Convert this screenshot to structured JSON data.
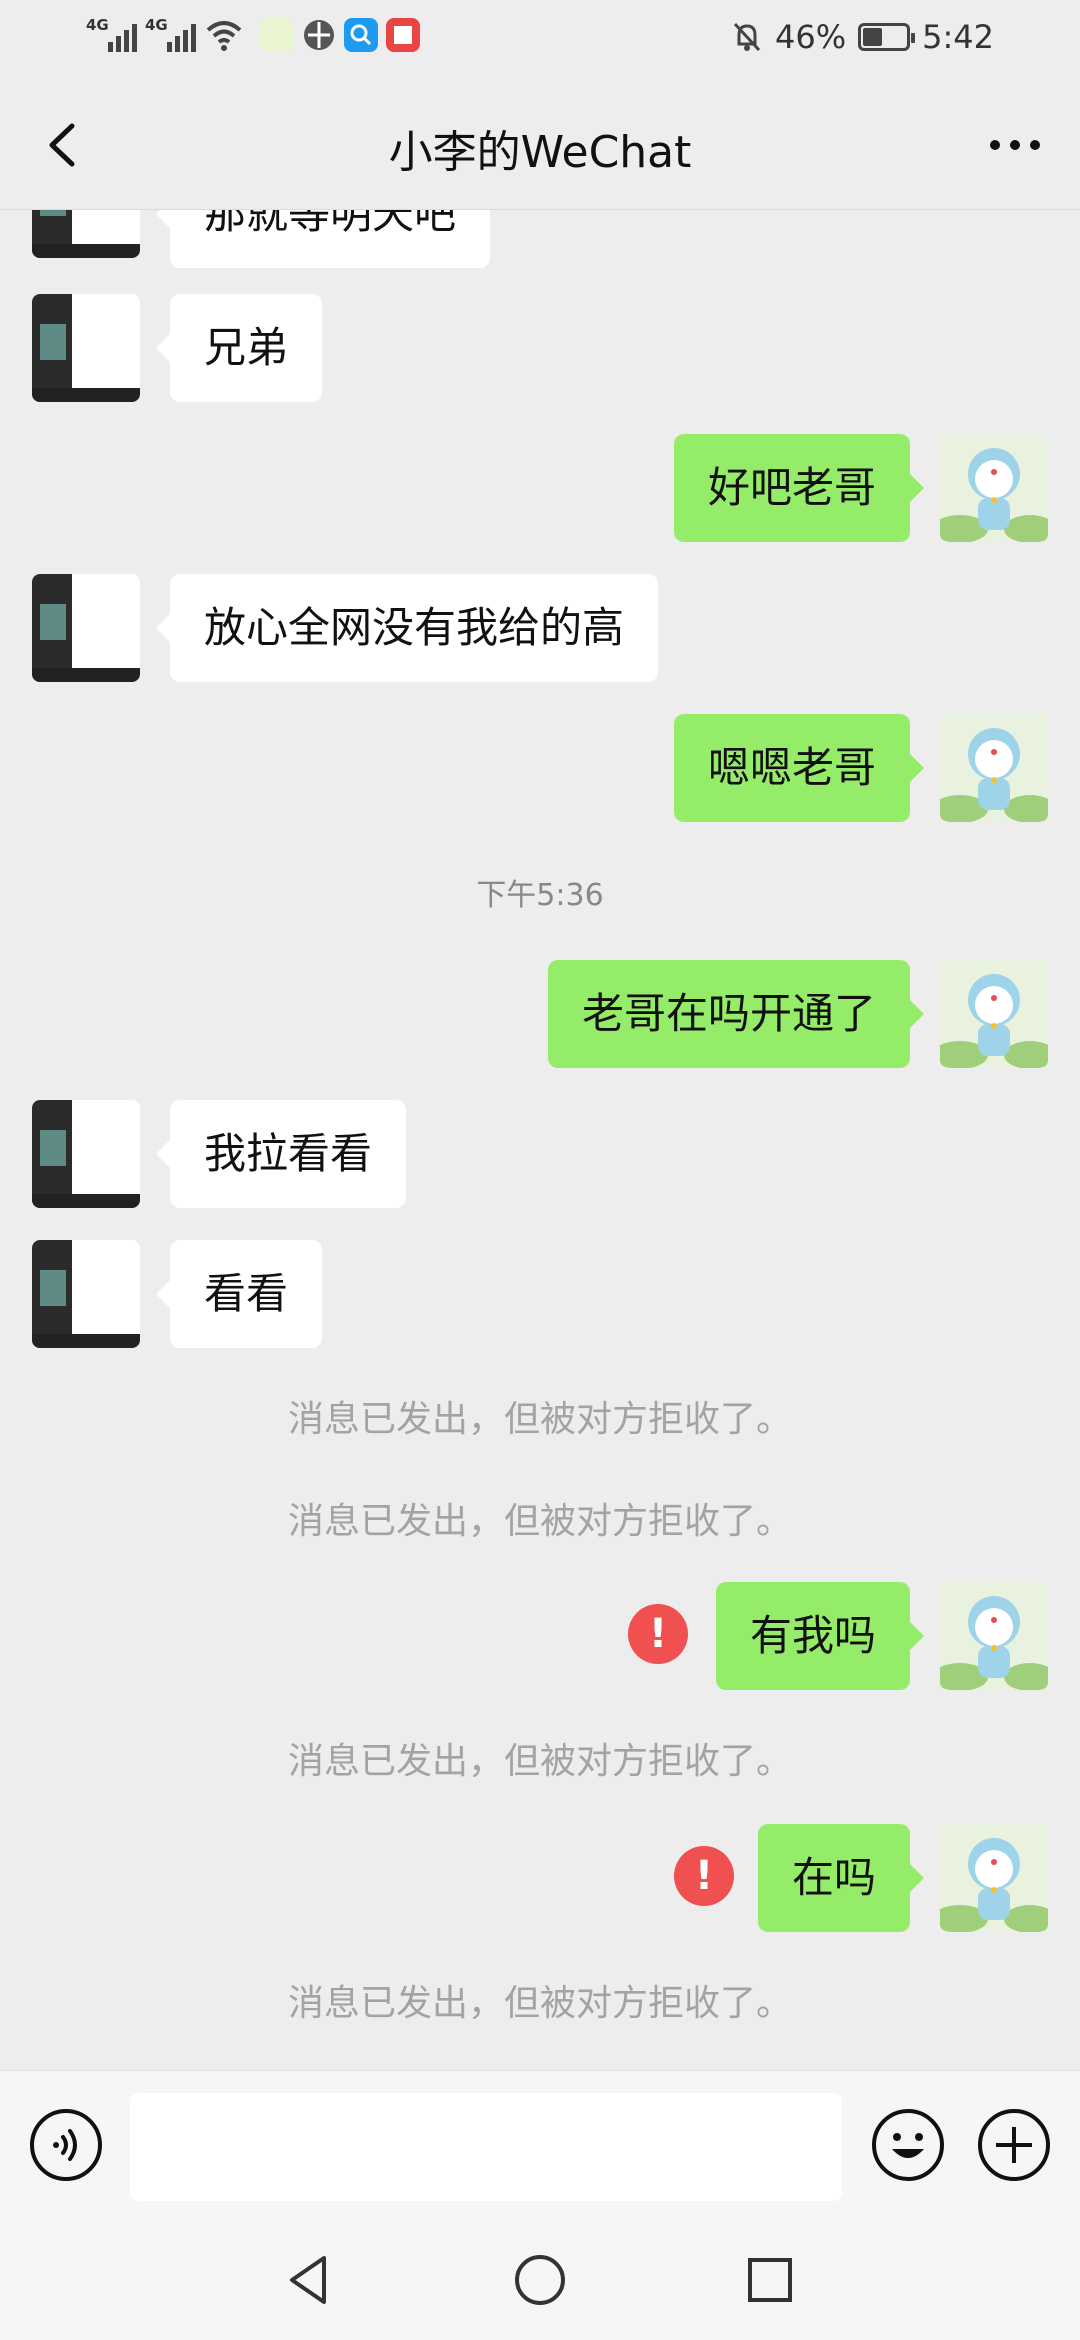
{
  "status_bar": {
    "network_1": "4G",
    "network_2": "4G",
    "battery_percent": "46%",
    "battery_level": 0.46,
    "time": "5:42"
  },
  "header": {
    "title": "小李的WeChat",
    "back_icon": "chevron-left-icon",
    "more_icon": "more-horizontal-icon"
  },
  "messages": [
    {
      "type": "in",
      "text": "那就等明天吧"
    },
    {
      "type": "in",
      "text": "兄弟"
    },
    {
      "type": "out",
      "text": "好吧老哥"
    },
    {
      "type": "in",
      "text": "放心全网没有我给的高"
    },
    {
      "type": "out",
      "text": "嗯嗯老哥"
    },
    {
      "type": "time",
      "text": "下午5:36"
    },
    {
      "type": "out",
      "text": "老哥在吗开通了"
    },
    {
      "type": "in",
      "text": "我拉看看"
    },
    {
      "type": "in",
      "text": "看看"
    },
    {
      "type": "system",
      "text": "消息已发出，但被对方拒收了。"
    },
    {
      "type": "system",
      "text": "消息已发出，但被对方拒收了。"
    },
    {
      "type": "out",
      "text": "有我吗",
      "failed": true
    },
    {
      "type": "system",
      "text": "消息已发出，但被对方拒收了。"
    },
    {
      "type": "out",
      "text": "在吗",
      "failed": true
    },
    {
      "type": "system",
      "text": "消息已发出，但被对方拒收了。"
    }
  ],
  "error_mark": "!",
  "input_bar": {
    "placeholder": "",
    "voice_icon": "voice-icon",
    "emoji_icon": "emoji-icon",
    "plus_icon": "plus-circle-icon"
  },
  "colors": {
    "background": "#ededed",
    "incoming_bubble": "#ffffff",
    "outgoing_bubble": "#95ec69",
    "error": "#f05050"
  }
}
